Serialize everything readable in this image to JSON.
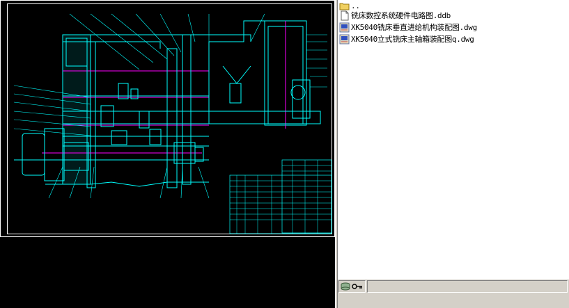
{
  "file_list": {
    "items": [
      {
        "name": "..",
        "icon": "folder-up-icon"
      },
      {
        "name": "铣床数控系统硬件电路图.ddb",
        "icon": "ddb-file-icon"
      },
      {
        "name": "XK5040铣床垂直进给机构装配图.dwg",
        "icon": "dwg-file-icon"
      },
      {
        "name": "XK5040立式铣床主轴箱装配图q.dwg",
        "icon": "dwg-file-icon"
      }
    ]
  },
  "colors": {
    "drawing_background": "#000000",
    "drawing_lines": "#00ffff",
    "drawing_accent": "#ff00ff",
    "drawing_border": "#ffffff",
    "panel_background": "#ffffff",
    "chrome": "#d4d0c8"
  }
}
